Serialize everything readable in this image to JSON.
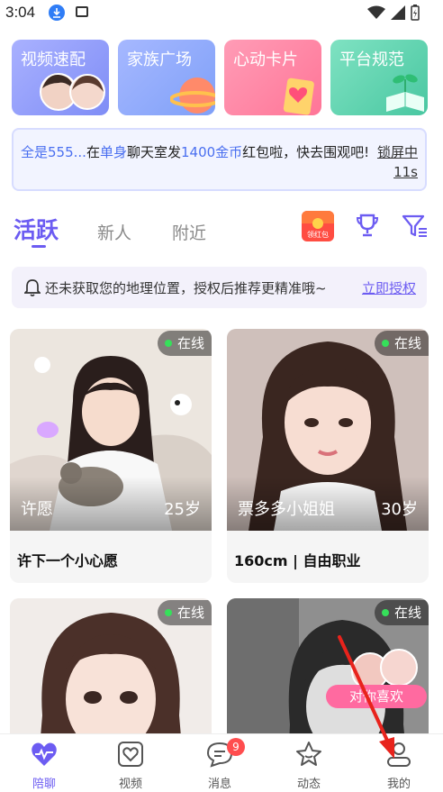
{
  "status_bar": {
    "time": "3:04"
  },
  "features": [
    {
      "label": "视频速配"
    },
    {
      "label": "家族广场"
    },
    {
      "label": "心动卡片"
    },
    {
      "label": "平台规范"
    }
  ],
  "announcement": {
    "user": "全是555...",
    "text_at": "在",
    "room": "单身",
    "text_mid": "聊天室发",
    "amount": "1400金币",
    "text_tail": "红包啦，快去围观吧!",
    "lock_label": "锁屏中",
    "countdown": "11s"
  },
  "tabs": [
    {
      "label": "活跃",
      "active": true
    },
    {
      "label": "新人"
    },
    {
      "label": "附近"
    }
  ],
  "redpack": {
    "label": "领红包"
  },
  "location_bar": {
    "message": "还未获取您的地理位置，授权后推荐更精准哦~",
    "action": "立即授权"
  },
  "profiles": [
    {
      "name": "许愿",
      "age": "25岁",
      "status": "在线",
      "info": "许下一个小心愿"
    },
    {
      "name": "票多多小姐姐",
      "age": "30岁",
      "status": "在线",
      "info": "160cm | 自由职业"
    },
    {
      "status": "在线"
    },
    {
      "status": "在线",
      "like_badge": "对你喜欢"
    }
  ],
  "bottom_nav": [
    {
      "label": "陪聊",
      "icon": "heart-pulse-icon",
      "active": true
    },
    {
      "label": "视频",
      "icon": "video-heart-icon"
    },
    {
      "label": "消息",
      "icon": "chat-icon",
      "badge": "9"
    },
    {
      "label": "动态",
      "icon": "star-icon"
    },
    {
      "label": "我的",
      "icon": "user-icon"
    }
  ],
  "colors": {
    "accent": "#6c5cf2",
    "online": "#36e05a",
    "badge": "#ff4d4f"
  }
}
